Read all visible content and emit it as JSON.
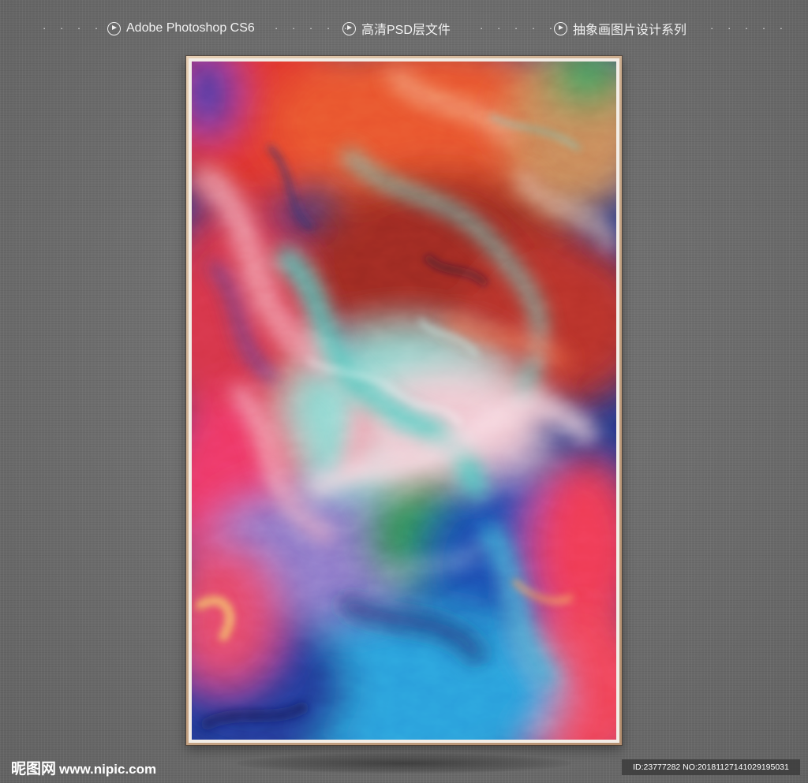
{
  "top_bar": {
    "items": [
      {
        "label": "Adobe Photoshop CS6",
        "icon": "play-circle-icon"
      },
      {
        "label": "高清PSD层文件",
        "icon": "play-circle-icon"
      },
      {
        "label": "抽象画图片设计系列",
        "icon": "play-circle-icon"
      }
    ],
    "separator": "· · · · ·"
  },
  "artwork": {
    "subject": "abstract painting in gilt frame",
    "frame_color": "#c9a98a",
    "dominant_colors": [
      "#e8294e",
      "#2a9ad6",
      "#5fd4c8",
      "#c2271e",
      "#1d2f7a",
      "#f06a3a"
    ]
  },
  "watermark": {
    "site_cn": "昵图网",
    "site_url": "www.nipic.com",
    "id_text": "ID:23777282 NO:20181127141029195031"
  }
}
